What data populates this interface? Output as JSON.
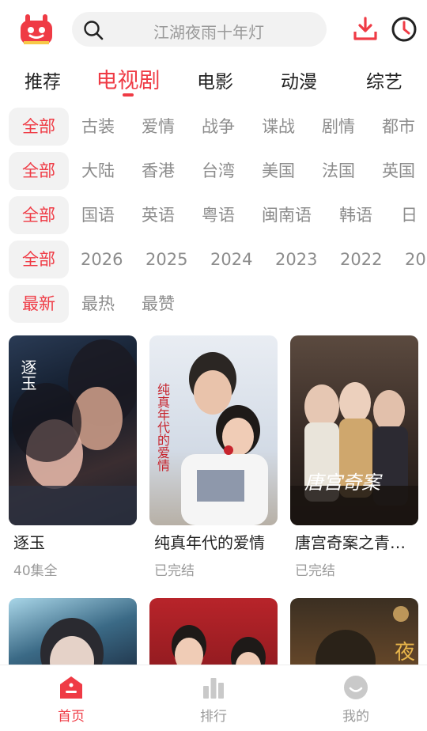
{
  "header": {
    "search_placeholder": "江湖夜雨十年灯",
    "logo_icon": "app-logo-icon",
    "download_icon": "download-icon",
    "history_icon": "history-clock-icon"
  },
  "tabs": [
    {
      "label": "推荐",
      "active": false
    },
    {
      "label": "电视剧",
      "active": true
    },
    {
      "label": "电影",
      "active": false
    },
    {
      "label": "动漫",
      "active": false
    },
    {
      "label": "综艺",
      "active": false
    }
  ],
  "filters": {
    "genre": [
      "全部",
      "古装",
      "爱情",
      "战争",
      "谍战",
      "剧情",
      "都市"
    ],
    "region": [
      "全部",
      "大陆",
      "香港",
      "台湾",
      "美国",
      "法国",
      "英国"
    ],
    "language": [
      "全部",
      "国语",
      "英语",
      "粤语",
      "闽南语",
      "韩语",
      "日"
    ],
    "year": [
      "全部",
      "2026",
      "2025",
      "2024",
      "2023",
      "2022",
      "20"
    ],
    "sort": [
      "最新",
      "最热",
      "最赞"
    ]
  },
  "cards": [
    {
      "title": "逐玉",
      "sub": "40集全",
      "poster_text": "逐玉"
    },
    {
      "title": "纯真年代的爱情",
      "sub": "已完结",
      "poster_text": "纯真年代的爱情"
    },
    {
      "title": "唐宫奇案之青雾风鸣",
      "sub": "已完结",
      "poster_text": "唐宫奇案"
    }
  ],
  "partial_cards": [
    {
      "poster_text": ""
    },
    {
      "poster_text": ""
    },
    {
      "poster_text": "夜"
    }
  ],
  "bottom_nav": [
    {
      "label": "首页",
      "active": true,
      "icon": "home-icon"
    },
    {
      "label": "排行",
      "active": false,
      "icon": "ranking-bar-chart-icon"
    },
    {
      "label": "我的",
      "active": false,
      "icon": "profile-smile-icon"
    }
  ],
  "colors": {
    "accent": "#ef3b45",
    "chip_bg": "#f2f2f2",
    "muted": "#9a9a9a"
  }
}
